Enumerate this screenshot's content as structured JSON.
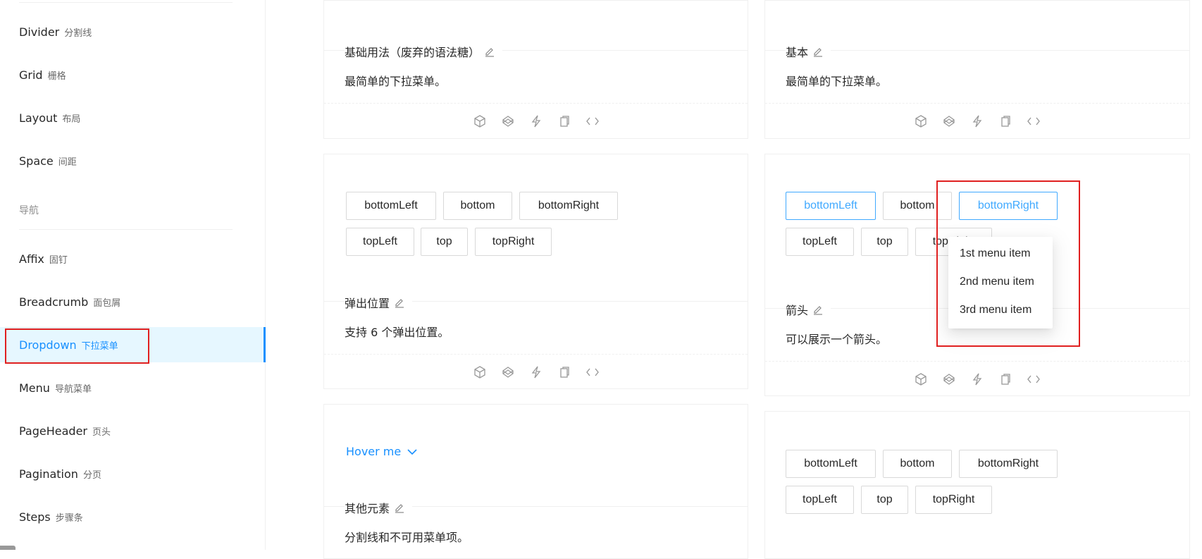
{
  "sidebar": {
    "items": [
      {
        "en": "Divider",
        "zh": "分割线"
      },
      {
        "en": "Grid",
        "zh": "栅格"
      },
      {
        "en": "Layout",
        "zh": "布局"
      },
      {
        "en": "Space",
        "zh": "间距"
      },
      {
        "en": "Affix",
        "zh": "固钉"
      },
      {
        "en": "Breadcrumb",
        "zh": "面包屑"
      },
      {
        "en": "Dropdown",
        "zh": "下拉菜单"
      },
      {
        "en": "Menu",
        "zh": "导航菜单"
      },
      {
        "en": "PageHeader",
        "zh": "页头"
      },
      {
        "en": "Pagination",
        "zh": "分页"
      },
      {
        "en": "Steps",
        "zh": "步骤条"
      }
    ],
    "group_nav": "导航",
    "active_index": 6
  },
  "demos": {
    "basic_legacy": {
      "title": "基础用法（废弃的语法糖）",
      "desc": "最简单的下拉菜单。"
    },
    "basic": {
      "title": "基本",
      "desc": "最简单的下拉菜单。"
    },
    "placement": {
      "title": "弹出位置",
      "desc": "支持 6 个弹出位置。"
    },
    "arrow": {
      "title": "箭头",
      "desc": "可以展示一个箭头。"
    },
    "other": {
      "title": "其他元素",
      "desc": "分割线和不可用菜单项。",
      "link": "Hover me"
    }
  },
  "placements": [
    "bottomLeft",
    "bottom",
    "bottomRight",
    "topLeft",
    "top",
    "topRight"
  ],
  "dropdown_menu": [
    "1st menu item",
    "2nd menu item",
    "3rd menu item"
  ],
  "colors": {
    "primary": "#1890ff",
    "highlight_box": "#e02020"
  }
}
